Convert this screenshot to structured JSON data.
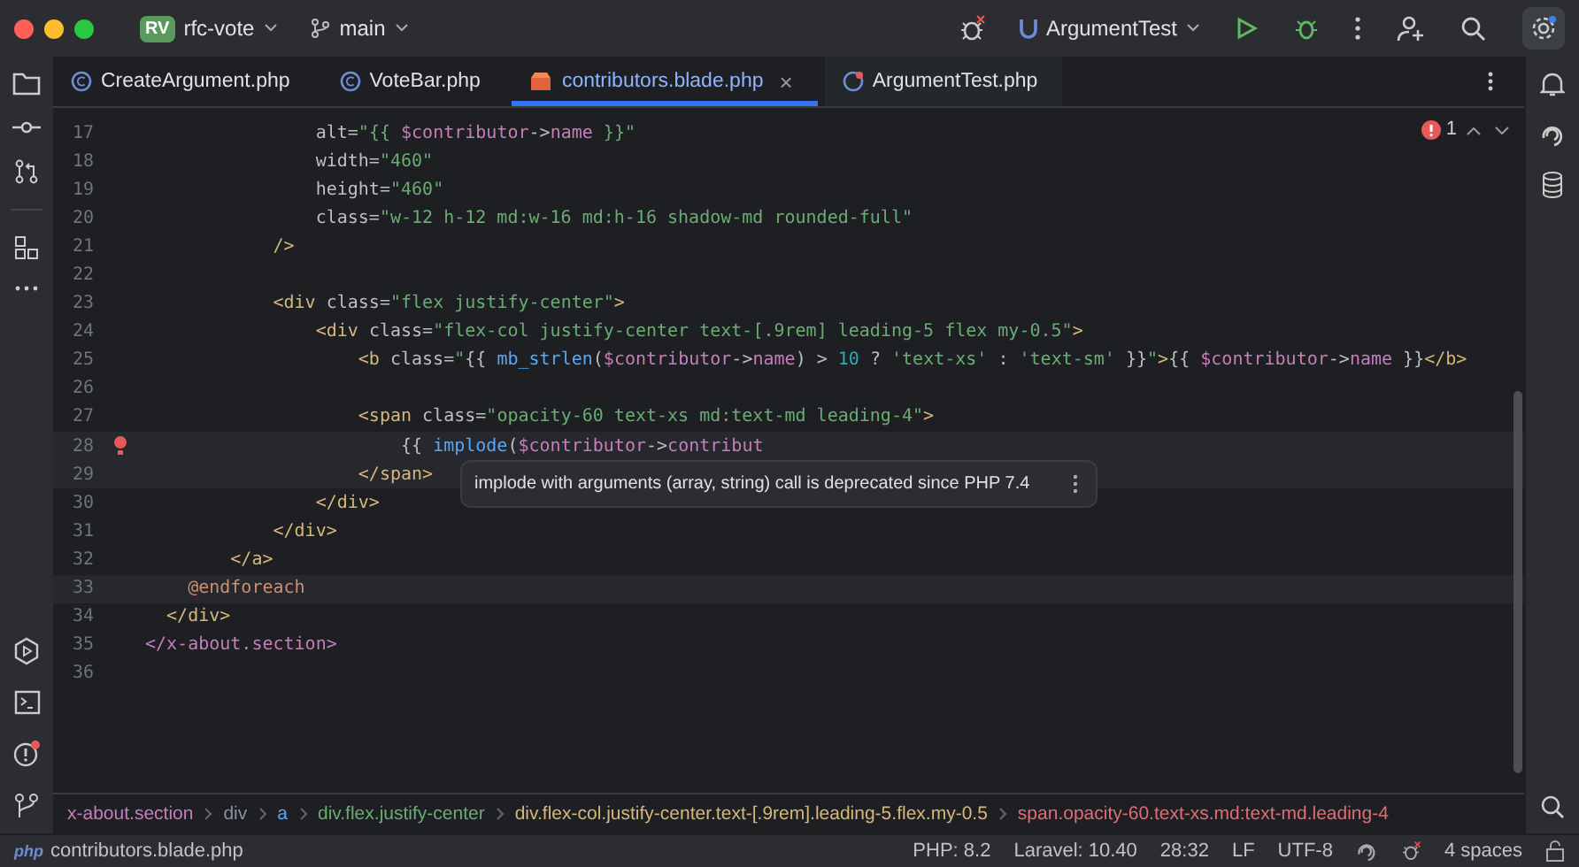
{
  "title_bar": {
    "project_badge": "RV",
    "project": "rfc-vote",
    "branch": "main",
    "run_config": "ArgumentTest"
  },
  "tabs": [
    {
      "label": "CreateArgument.php",
      "selected": false,
      "kind": "class"
    },
    {
      "label": "VoteBar.php",
      "selected": false,
      "kind": "class"
    },
    {
      "label": "contributors.blade.php",
      "selected": true,
      "kind": "blade"
    },
    {
      "label": "ArgumentTest.php",
      "selected": false,
      "kind": "test"
    }
  ],
  "tab_close": "×",
  "problems": {
    "count": "1"
  },
  "editor": {
    "lines": [
      {
        "number": "17",
        "highlighted": false,
        "tokens": [
          {
            "kind": "attr",
            "text": "                alt="
          },
          {
            "kind": "str",
            "text": "\"{{ "
          },
          {
            "kind": "var",
            "text": "$contributor"
          },
          {
            "kind": "punct",
            "text": "->"
          },
          {
            "kind": "prop",
            "text": "name"
          },
          {
            "kind": "str",
            "text": " }}\""
          }
        ]
      },
      {
        "number": "18",
        "highlighted": false,
        "tokens": [
          {
            "kind": "attr",
            "text": "                width="
          },
          {
            "kind": "str",
            "text": "\"460\""
          }
        ]
      },
      {
        "number": "19",
        "highlighted": false,
        "tokens": [
          {
            "kind": "attr",
            "text": "                height="
          },
          {
            "kind": "str",
            "text": "\"460\""
          }
        ]
      },
      {
        "number": "20",
        "highlighted": false,
        "tokens": [
          {
            "kind": "attr",
            "text": "                class="
          },
          {
            "kind": "str",
            "text": "\"w-12 h-12 md:w-16 md:h-16 shadow-md rounded-full\""
          }
        ]
      },
      {
        "number": "21",
        "highlighted": false,
        "tokens": [
          {
            "kind": "tag",
            "text": "            />"
          }
        ]
      },
      {
        "number": "22",
        "highlighted": false
      },
      {
        "number": "23",
        "highlighted": false,
        "tokens": [
          {
            "kind": "tag",
            "text": "            <div"
          },
          {
            "kind": "attr",
            "text": " class="
          },
          {
            "kind": "str",
            "text": "\"flex justify-center\""
          },
          {
            "kind": "tag",
            "text": ">"
          }
        ]
      },
      {
        "number": "24",
        "highlighted": false,
        "tokens": [
          {
            "kind": "tag",
            "text": "                <div"
          },
          {
            "kind": "attr",
            "text": " class="
          },
          {
            "kind": "str",
            "text": "\"flex-col justify-center text-[.9rem] leading-5 flex my-0.5\""
          },
          {
            "kind": "tag",
            "text": ">"
          }
        ]
      },
      {
        "number": "25",
        "highlighted": false,
        "tokens": [
          {
            "kind": "tag",
            "text": "                    <b"
          },
          {
            "kind": "attr",
            "text": " class="
          },
          {
            "kind": "str",
            "text": "\""
          },
          {
            "kind": "punct",
            "text": "{{ "
          },
          {
            "kind": "fn",
            "text": "mb_strlen"
          },
          {
            "kind": "punct",
            "text": "("
          },
          {
            "kind": "var",
            "text": "$contributor"
          },
          {
            "kind": "punct",
            "text": "->"
          },
          {
            "kind": "prop",
            "text": "name"
          },
          {
            "kind": "punct",
            "text": ") > "
          },
          {
            "kind": "num",
            "text": "10"
          },
          {
            "kind": "punct",
            "text": " ? "
          },
          {
            "kind": "str",
            "text": "'text-xs'"
          },
          {
            "kind": "punct",
            "text": " : "
          },
          {
            "kind": "str",
            "text": "'text-sm'"
          },
          {
            "kind": "punct",
            "text": " }}"
          },
          {
            "kind": "str",
            "text": "\""
          },
          {
            "kind": "tag",
            "text": ">"
          },
          {
            "kind": "punct",
            "text": "{{ "
          },
          {
            "kind": "var",
            "text": "$contributor"
          },
          {
            "kind": "punct",
            "text": "->"
          },
          {
            "kind": "prop",
            "text": "name"
          },
          {
            "kind": "punct",
            "text": " }}"
          },
          {
            "kind": "tag",
            "text": "</b>"
          }
        ]
      },
      {
        "number": "26",
        "highlighted": false
      },
      {
        "number": "27",
        "highlighted": false,
        "tokens": [
          {
            "kind": "tag",
            "text": "                    <span"
          },
          {
            "kind": "attr",
            "text": " class="
          },
          {
            "kind": "str",
            "text": "\"opacity-60 text-xs md:text-md leading-4\""
          },
          {
            "kind": "tag",
            "text": ">"
          }
        ]
      },
      {
        "number": "28",
        "highlighted": true,
        "tokens": [
          {
            "kind": "punct",
            "text": "                        {{ "
          },
          {
            "kind": "fn",
            "text": "implode"
          },
          {
            "kind": "punct",
            "text": "("
          },
          {
            "kind": "var",
            "text": "$contributor"
          },
          {
            "kind": "punct",
            "text": "->"
          },
          {
            "kind": "prop",
            "text": "contribut"
          }
        ]
      },
      {
        "number": "29",
        "highlighted": true,
        "tokens": [
          {
            "kind": "tag",
            "text": "                    </span>"
          }
        ]
      },
      {
        "number": "30",
        "highlighted": false,
        "tokens": [
          {
            "kind": "tag",
            "text": "                </div>"
          }
        ]
      },
      {
        "number": "31",
        "highlighted": false,
        "tokens": [
          {
            "kind": "tag",
            "text": "            </div>"
          }
        ]
      },
      {
        "number": "32",
        "highlighted": false,
        "tokens": [
          {
            "kind": "tag",
            "text": "        </a>"
          }
        ]
      },
      {
        "number": "33",
        "highlighted": true,
        "tokens": [
          {
            "kind": "directive",
            "text": "    @endforeach"
          }
        ]
      },
      {
        "number": "34",
        "highlighted": false,
        "tokens": [
          {
            "kind": "tag",
            "text": "  </div>"
          }
        ]
      },
      {
        "number": "35",
        "highlighted": false,
        "tokens": [
          {
            "kind": "tag2",
            "text": "</x-about.section>"
          }
        ]
      },
      {
        "number": "36",
        "highlighted": false
      }
    ],
    "tooltip": "implode with arguments (array, string) call is deprecated since PHP 7.4"
  },
  "breadcrumbs": [
    {
      "label": "x-about.section",
      "color": "#c77dbb"
    },
    {
      "label": "div",
      "color": "#8c8fa8"
    },
    {
      "label": "a",
      "color": "#56a8f5"
    },
    {
      "label": "div.flex.justify-center",
      "color": "#6aab73"
    },
    {
      "label": "div.flex-col.justify-center.text-[.9rem].leading-5.flex.my-0.5",
      "color": "#d5b778"
    },
    {
      "label": "span.opacity-60.text-xs.md:text-md.leading-4",
      "color": "#e06c75"
    }
  ],
  "status_bar": {
    "file_badge": "php",
    "file": "contributors.blade.php",
    "php": "PHP: 8.2",
    "laravel": "Laravel: 10.40",
    "position": "28:32",
    "line_ending": "LF",
    "encoding": "UTF-8",
    "indent": "4 spaces"
  }
}
